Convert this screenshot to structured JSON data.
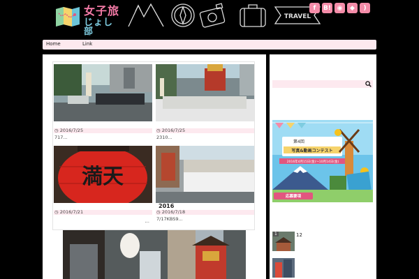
{
  "header": {
    "logo_line1": "女子旅",
    "logo_line2": "じょし部",
    "doodle_tag": "TRAVEL"
  },
  "social": [
    {
      "label": "f",
      "icon": "facebook-icon"
    },
    {
      "label": "B!",
      "icon": "hatena-bookmark-icon"
    },
    {
      "label": "◉",
      "icon": "instagram-icon"
    },
    {
      "label": "◆",
      "icon": "feedly-icon"
    },
    {
      "label": ")",
      "icon": "rss-icon"
    }
  ],
  "nav": {
    "home": "Home",
    "link": "Link"
  },
  "posts": [
    {
      "date": "2016/7/25",
      "excerpt": "717..."
    },
    {
      "date": "2016/7/25",
      "excerpt": "2310..."
    },
    {
      "date": "2016/7/21",
      "excerpt": "",
      "more": "..."
    },
    {
      "title": "2016",
      "date": "2016/7/18",
      "excerpt": "7/17KBS9..."
    }
  ],
  "lantern_text": "満天",
  "banner": {
    "line1": "第4回",
    "line2": "写真&動画コンテスト",
    "line3": "2016年4月15日(金)〜10月14日(金)",
    "cta": "応募要項"
  },
  "sidebar": {
    "recent_count": "12",
    "recent_badge": "1"
  },
  "colors": {
    "accent_pink": "#f48ca8",
    "nav_bg": "#fde9ef",
    "logo_blue": "#7ecce0"
  }
}
